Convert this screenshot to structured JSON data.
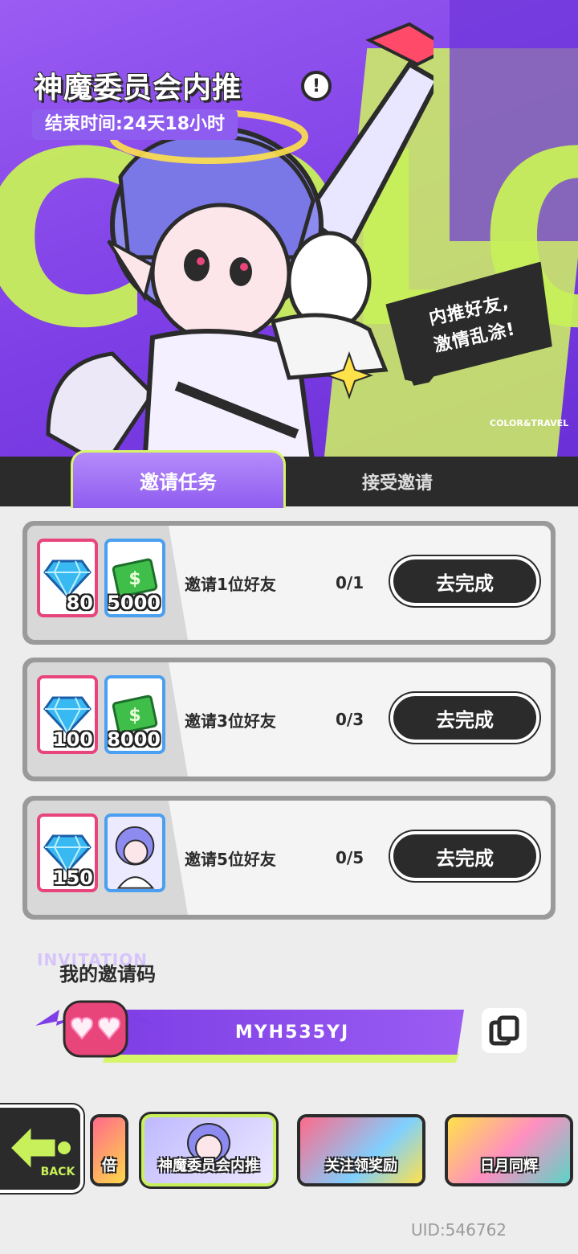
{
  "header": {
    "title": "神魔委员会内推",
    "info_icon": "!",
    "end_time": "结束时间:24天18小时",
    "slogan_line1": "内推好友,",
    "slogan_line2": "激情乱涂!",
    "brand_mark": "COLOR&TRAVEL",
    "background_letters": "COLOR"
  },
  "tabs": [
    {
      "label": "邀请任务",
      "active": true
    },
    {
      "label": "接受邀请",
      "active": false
    }
  ],
  "tasks": [
    {
      "label": "邀请1位好友",
      "progress": "0/1",
      "button": "去完成",
      "rewards": [
        {
          "icon": "diamond-icon",
          "amount": "80"
        },
        {
          "icon": "cash-icon",
          "amount": "5000"
        }
      ]
    },
    {
      "label": "邀请3位好友",
      "progress": "0/3",
      "button": "去完成",
      "rewards": [
        {
          "icon": "diamond-icon",
          "amount": "100"
        },
        {
          "icon": "cash-icon",
          "amount": "8000"
        }
      ]
    },
    {
      "label": "邀请5位好友",
      "progress": "0/5",
      "button": "去完成",
      "rewards": [
        {
          "icon": "diamond-icon",
          "amount": "150"
        },
        {
          "icon": "character-card-icon",
          "amount": ""
        }
      ]
    }
  ],
  "invitation": {
    "watermark": "INVITATION",
    "title": "我的邀请码",
    "code": "MYH535YJ",
    "copy_icon": "copy-icon"
  },
  "bottom_nav": {
    "back_label": "BACK",
    "items": [
      {
        "label": "倍",
        "active": false
      },
      {
        "label": "神魔委员会内推",
        "active": true
      },
      {
        "label": "关注领奖励",
        "active": false
      },
      {
        "label": "日月同辉",
        "active": false
      }
    ]
  },
  "uid": "UID:546762",
  "colors": {
    "purple": "#8f5cf0",
    "lime": "#c8f05a",
    "dark": "#2b2b2b",
    "pink": "#e8457a",
    "blue": "#4a9ff0"
  }
}
